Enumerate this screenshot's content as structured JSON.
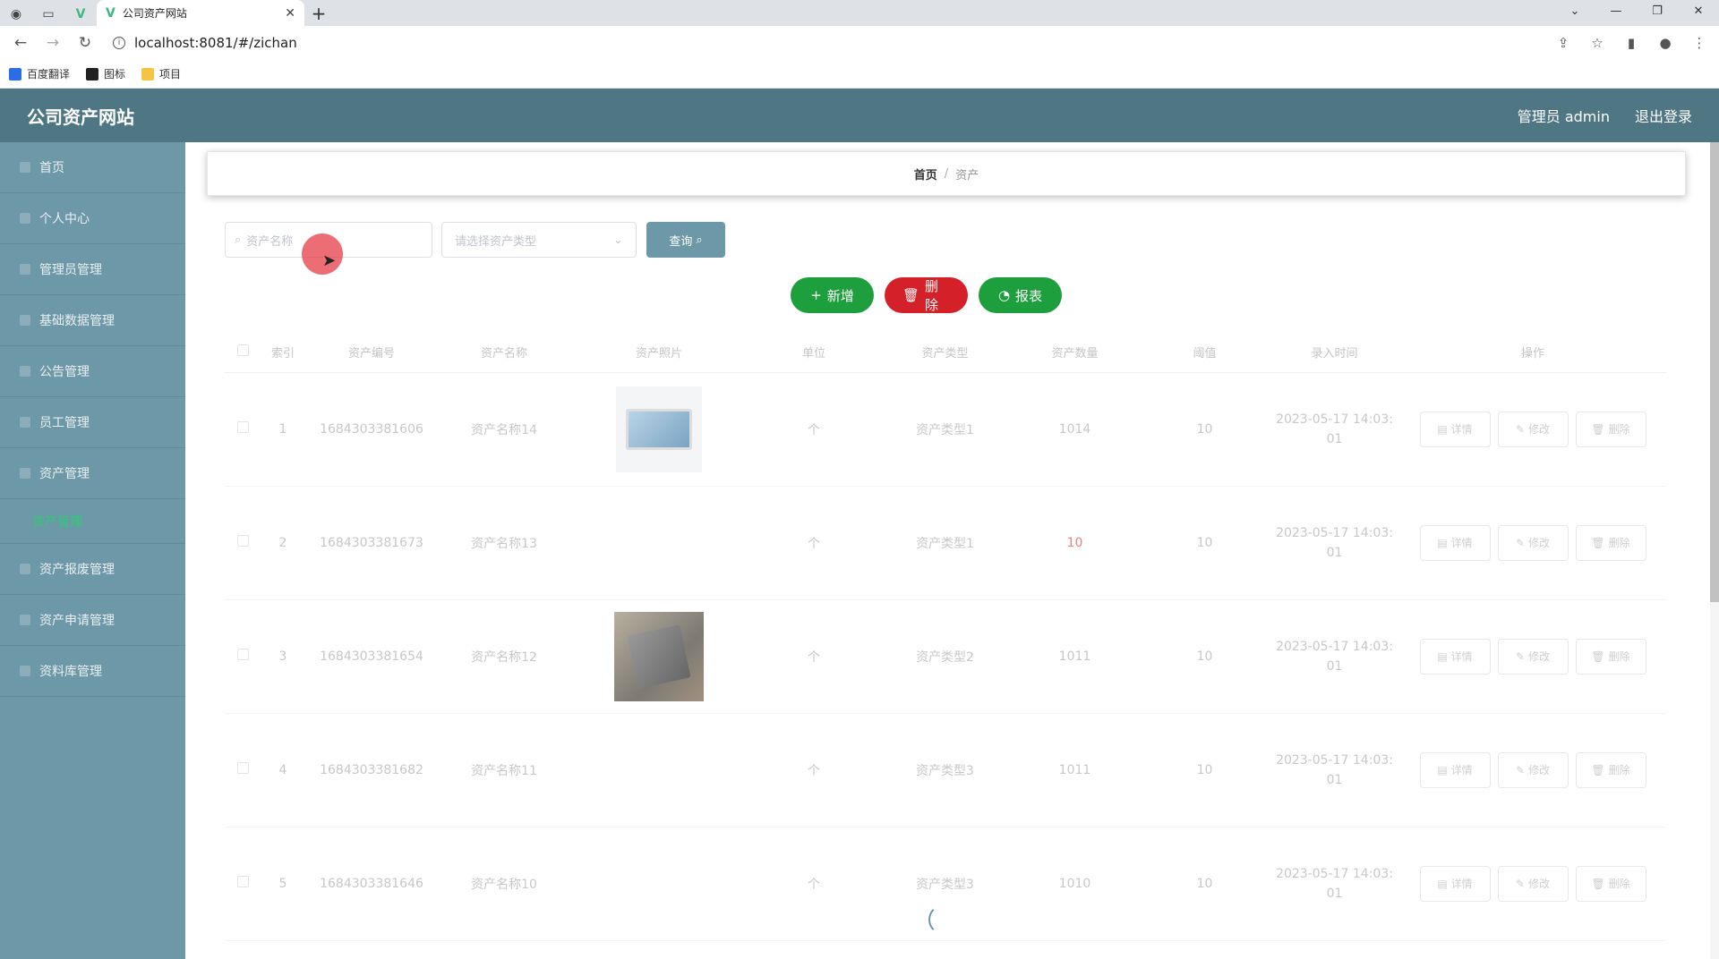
{
  "browser": {
    "tab_title": "公司资产网站",
    "url": "localhost:8081/#/zichan",
    "bookmarks": [
      "百度翻译",
      "图标",
      "项目"
    ]
  },
  "header": {
    "title": "公司资产网站",
    "user": "管理员 admin",
    "logout": "退出登录"
  },
  "sidebar": {
    "items": [
      {
        "label": "首页"
      },
      {
        "label": "个人中心"
      },
      {
        "label": "管理员管理"
      },
      {
        "label": "基础数据管理"
      },
      {
        "label": "公告管理"
      },
      {
        "label": "员工管理"
      },
      {
        "label": "资产管理"
      }
    ],
    "sub_item": "资产管理",
    "items_after": [
      {
        "label": "资产报废管理"
      },
      {
        "label": "资产申请管理"
      },
      {
        "label": "资料库管理"
      }
    ]
  },
  "breadcrumb": {
    "home": "首页",
    "separator": "/",
    "current": "资产"
  },
  "filters": {
    "search_placeholder": "资产名称",
    "type_placeholder": "请选择资产类型",
    "query_label": "查询"
  },
  "actions": {
    "add": "新增",
    "delete": "删除",
    "report": "报表"
  },
  "table": {
    "headers": [
      "索引",
      "资产编号",
      "资产名称",
      "资产照片",
      "单位",
      "资产类型",
      "资产数量",
      "阈值",
      "录入时间",
      "操作"
    ],
    "rows": [
      {
        "index": "1",
        "code": "1684303381606",
        "name": "资产名称14",
        "photo": "monitor",
        "unit": "个",
        "type": "资产类型1",
        "qty": "1014",
        "threshold": "10",
        "time1": "2023-05-17 14:03:",
        "time2": "01"
      },
      {
        "index": "2",
        "code": "1684303381673",
        "name": "资产名称13",
        "photo": "",
        "unit": "个",
        "type": "资产类型1",
        "qty": "10",
        "threshold": "10",
        "time1": "2023-05-17 14:03:",
        "time2": "01"
      },
      {
        "index": "3",
        "code": "1684303381654",
        "name": "资产名称12",
        "photo": "laptop",
        "unit": "个",
        "type": "资产类型2",
        "qty": "1011",
        "threshold": "10",
        "time1": "2023-05-17 14:03:",
        "time2": "01"
      },
      {
        "index": "4",
        "code": "1684303381682",
        "name": "资产名称11",
        "photo": "",
        "unit": "个",
        "type": "资产类型3",
        "qty": "1011",
        "threshold": "10",
        "time1": "2023-05-17 14:03:",
        "time2": "01"
      },
      {
        "index": "5",
        "code": "1684303381646",
        "name": "资产名称10",
        "photo": "",
        "unit": "个",
        "type": "资产类型3",
        "qty": "1010",
        "threshold": "10",
        "time1": "2023-05-17 14:03:",
        "time2": "01"
      }
    ],
    "op_labels": {
      "detail": "详情",
      "edit": "修改",
      "delete": "删除"
    }
  },
  "colors": {
    "header": "#4e7683",
    "sidebar": "#6d98a8",
    "green": "#1e9f3e",
    "red": "#d42029"
  }
}
